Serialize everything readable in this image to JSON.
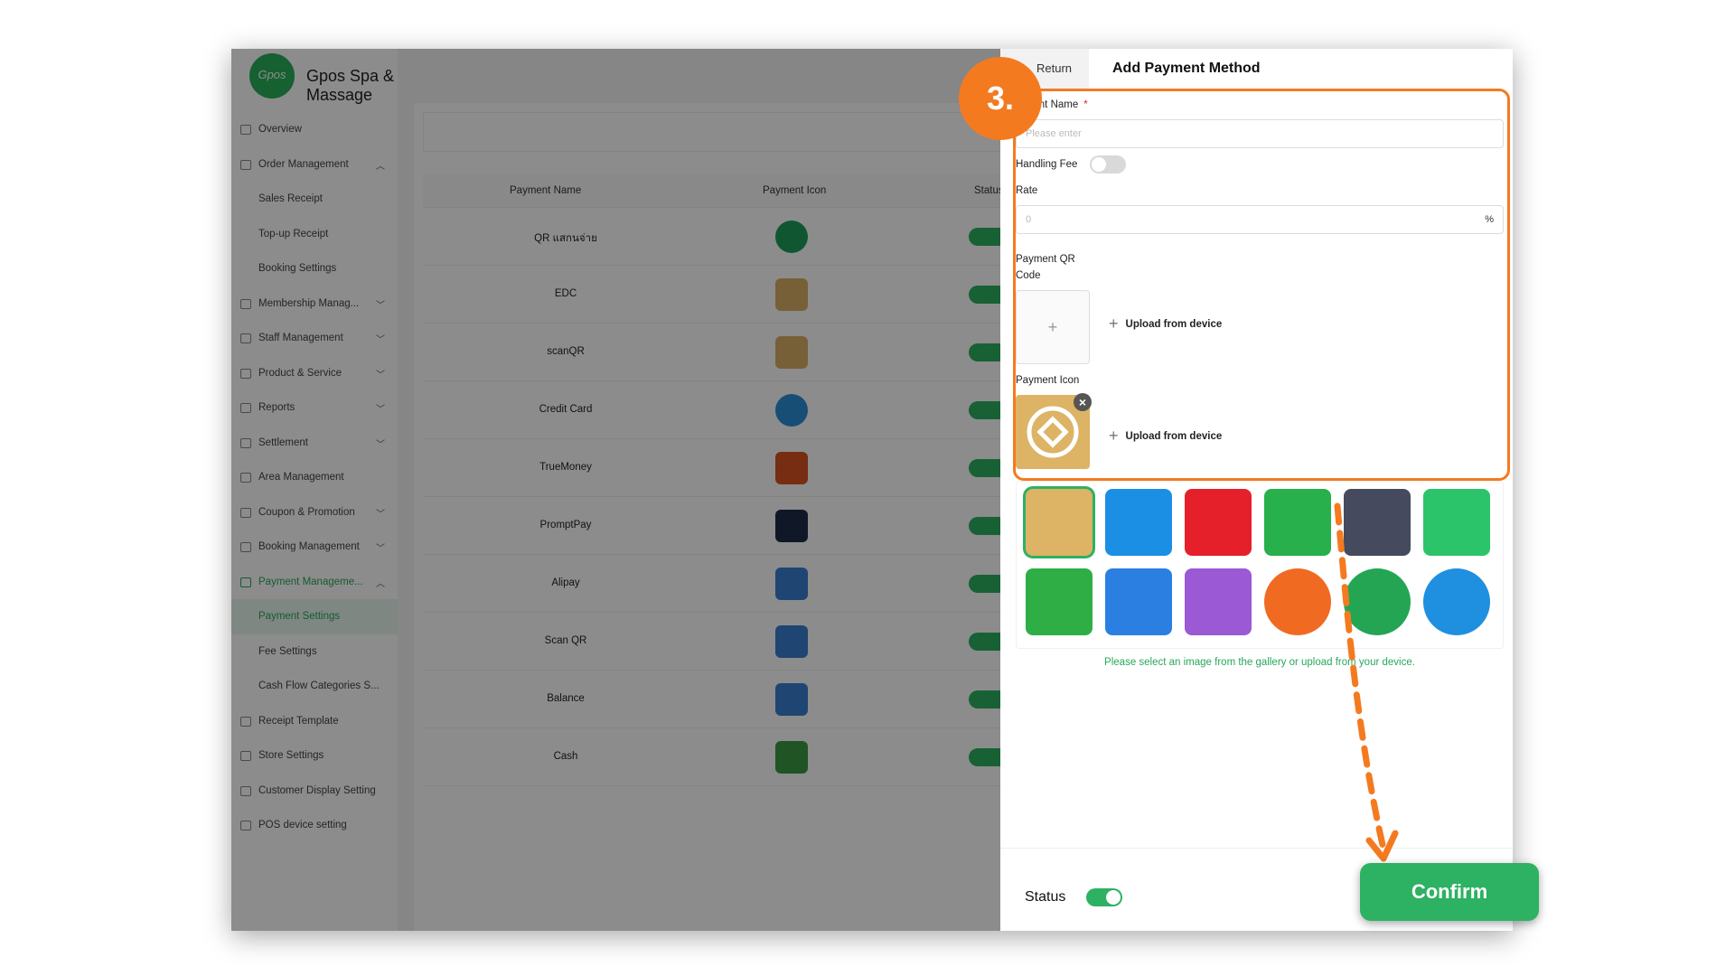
{
  "app": {
    "brand": "Gpos Spa & Massage",
    "logo_text": "Gpos"
  },
  "sidebar": {
    "items": [
      {
        "label": "Overview",
        "icon": "overview-icon",
        "chevron": ""
      },
      {
        "label": "Order Management",
        "icon": "order-icon",
        "chevron": "^"
      },
      {
        "label": "Sales Receipt",
        "sub": true
      },
      {
        "label": "Top-up Receipt",
        "sub": true
      },
      {
        "label": "Booking Settings",
        "sub": true
      },
      {
        "label": "Membership Manag...",
        "icon": "membership-icon",
        "chevron": "v"
      },
      {
        "label": "Staff Management",
        "icon": "staff-icon",
        "chevron": "v"
      },
      {
        "label": "Product & Service",
        "icon": "product-icon",
        "chevron": "v"
      },
      {
        "label": "Reports",
        "icon": "reports-icon",
        "chevron": "v"
      },
      {
        "label": "Settlement",
        "icon": "settlement-icon",
        "chevron": "v"
      },
      {
        "label": "Area Management",
        "icon": "area-icon",
        "chevron": ""
      },
      {
        "label": "Coupon & Promotion",
        "icon": "coupon-icon",
        "chevron": "v"
      },
      {
        "label": "Booking Management",
        "icon": "booking-icon",
        "chevron": "v"
      },
      {
        "label": "Payment Manageme...",
        "icon": "payment-icon",
        "chevron": "^",
        "green": true
      },
      {
        "label": "Payment Settings",
        "sub": true,
        "active": true
      },
      {
        "label": "Fee Settings",
        "sub": true
      },
      {
        "label": "Cash Flow Categories S...",
        "sub": true
      },
      {
        "label": "Receipt Template",
        "icon": "receipt-icon",
        "chevron": ""
      },
      {
        "label": "Store Settings",
        "icon": "store-icon",
        "chevron": ""
      },
      {
        "label": "Customer Display Setting",
        "icon": "display-icon",
        "chevron": ""
      },
      {
        "label": "POS device setting",
        "icon": "pos-icon",
        "chevron": ""
      }
    ]
  },
  "table": {
    "headers": {
      "name": "Payment Name",
      "icon": "Payment Icon",
      "status": "Status"
    },
    "rows": [
      {
        "name": "QR แสกนจ่าย",
        "color": "#1e9e5a",
        "round": true
      },
      {
        "name": "EDC",
        "color": "#d9b064"
      },
      {
        "name": "scanQR",
        "color": "#d9b064"
      },
      {
        "name": "Credit Card",
        "color": "#2a8fd8",
        "round": true
      },
      {
        "name": "TrueMoney",
        "color": "#d8531f"
      },
      {
        "name": "PromptPay",
        "color": "#1e2d4a"
      },
      {
        "name": "Alipay",
        "color": "#3a7fd0"
      },
      {
        "name": "Scan QR",
        "color": "#3a7fd0"
      },
      {
        "name": "Balance",
        "color": "#3a7fd0"
      },
      {
        "name": "Cash",
        "color": "#3c9a42"
      }
    ]
  },
  "drawer": {
    "return_label": "Return",
    "title": "Add Payment Method",
    "payment_name_label": "nent Name",
    "required_mark": "*",
    "payment_name_placeholder": "Please enter",
    "handling_fee_label": "Handling Fee",
    "rate_label": "Rate",
    "rate_placeholder": "0",
    "rate_unit": "%",
    "qr_label_line1": "Payment QR",
    "qr_label_line2": "Code",
    "upload_plus": "+",
    "upload_label": "Upload from device",
    "payment_icon_label": "Payment Icon",
    "close_symbol": "×",
    "hint": "Please select an image from the gallery or upload from your device.",
    "status_label": "Status",
    "confirm_label": "Confirm",
    "gallery": [
      {
        "name": "edc-diamond-icon",
        "color": "#ddb365"
      },
      {
        "name": "globe-dollar-icon",
        "color": "#1b8fe3"
      },
      {
        "name": "dollar-badge-icon",
        "color": "#e5202a"
      },
      {
        "name": "banknote-icon",
        "color": "#27b04b"
      },
      {
        "name": "wallet-dollar-icon",
        "color": "#464a5e"
      },
      {
        "name": "hand-coins-icon",
        "color": "#2cc46a"
      },
      {
        "name": "green-wallet-icon",
        "color": "#2fae46"
      },
      {
        "name": "paypal-icon",
        "color": "#2b7fe0"
      },
      {
        "name": "purple-card-icon",
        "color": "#9b59d6"
      },
      {
        "name": "orange-coins-icon",
        "color": "#f06a22"
      },
      {
        "name": "green-coins-icon",
        "color": "#24a554"
      },
      {
        "name": "blue-coins-icon",
        "color": "#1f8fe0"
      }
    ]
  },
  "annotation": {
    "step": "3.",
    "accent": "#f47a20"
  }
}
